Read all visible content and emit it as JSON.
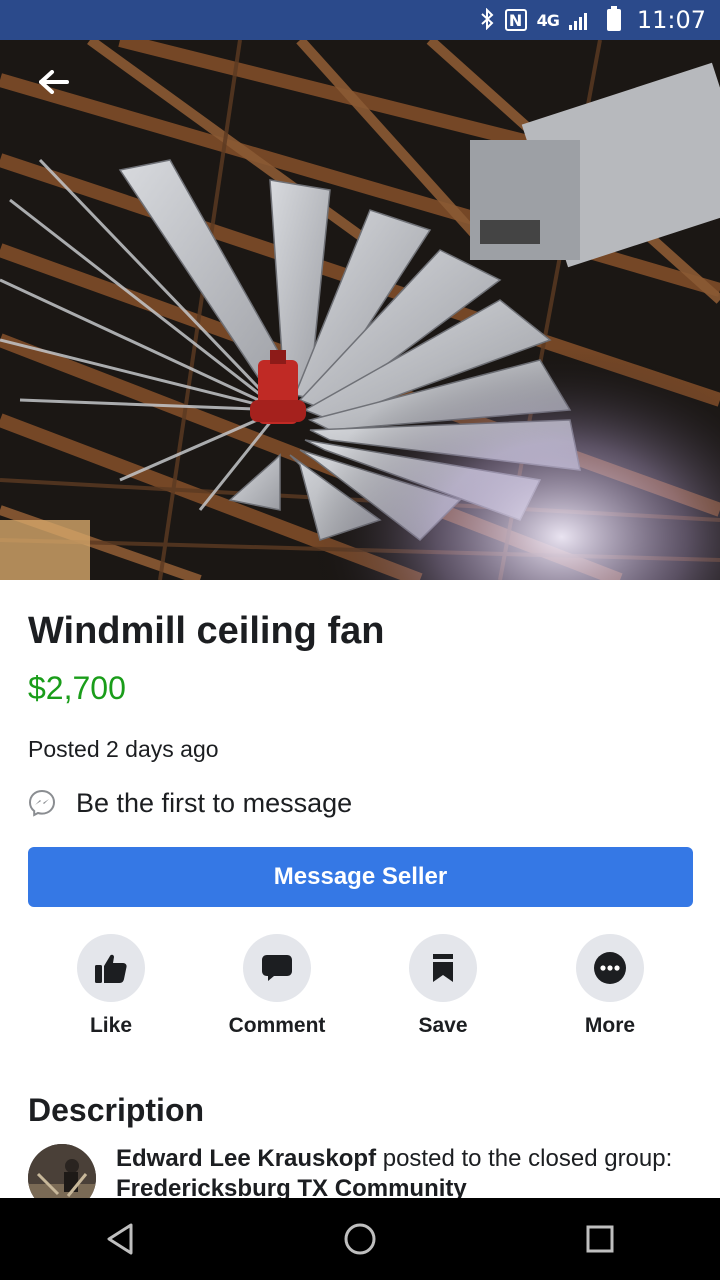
{
  "status_bar": {
    "time": "11:07",
    "network": "4G",
    "icons": [
      "bluetooth-icon",
      "nfc-icon",
      "lte-icon",
      "signal-icon",
      "battery-icon"
    ]
  },
  "listing": {
    "title": "Windmill ceiling fan",
    "price": "$2,700",
    "posted": "Posted 2 days ago",
    "message_hint": "Be the first to message",
    "cta_label": "Message Seller"
  },
  "actions": [
    {
      "label": "Like",
      "icon": "thumbs-up-icon"
    },
    {
      "label": "Comment",
      "icon": "comment-icon"
    },
    {
      "label": "Save",
      "icon": "bookmark-icon"
    },
    {
      "label": "More",
      "icon": "more-icon"
    }
  ],
  "description": {
    "heading": "Description",
    "author": "Edward Lee Krauskopf",
    "middle_text": " posted to the closed group: ",
    "group": "Fredericksburg TX Community"
  },
  "colors": {
    "status_bar": "#2b4a8b",
    "price": "#1a9d1a",
    "cta": "#3578e5",
    "action_circle": "#e4e6eb"
  }
}
